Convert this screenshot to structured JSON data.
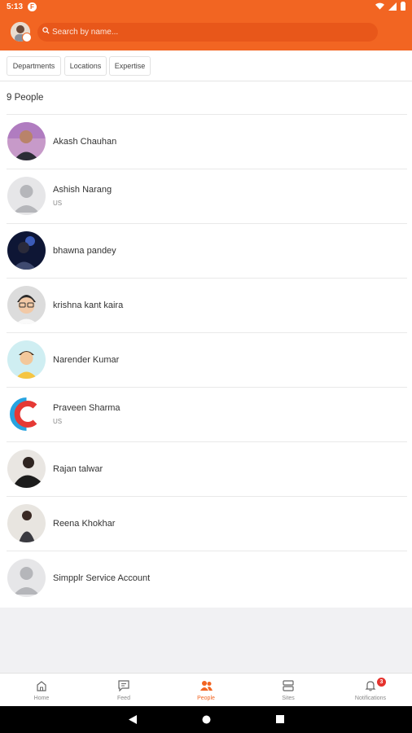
{
  "status_bar": {
    "time": "5:13",
    "app_icon": "F"
  },
  "search": {
    "placeholder": "Search by name..."
  },
  "filters": [
    {
      "label": "Departments"
    },
    {
      "label": "Locations"
    },
    {
      "label": "Expertise"
    }
  ],
  "people_count": "9 People",
  "people": [
    {
      "name": "Akash Chauhan",
      "location": "",
      "avatar": "photo"
    },
    {
      "name": "Ashish Narang",
      "location": "US",
      "avatar": "default"
    },
    {
      "name": "bhawna pandey",
      "location": "",
      "avatar": "photo"
    },
    {
      "name": "krishna kant kaira",
      "location": "",
      "avatar": "cartoon"
    },
    {
      "name": "Narender Kumar",
      "location": "",
      "avatar": "cartoon"
    },
    {
      "name": "Praveen Sharma",
      "location": "US",
      "avatar": "logo"
    },
    {
      "name": "Rajan talwar",
      "location": "",
      "avatar": "photo"
    },
    {
      "name": "Reena Khokhar",
      "location": "",
      "avatar": "photo"
    },
    {
      "name": "Simpplr Service Account",
      "location": "",
      "avatar": "default"
    }
  ],
  "bottom_nav": {
    "items": [
      {
        "label": "Home",
        "icon": "home-icon"
      },
      {
        "label": "Feed",
        "icon": "feed-icon"
      },
      {
        "label": "People",
        "icon": "people-icon",
        "active": true
      },
      {
        "label": "Sites",
        "icon": "sites-icon"
      },
      {
        "label": "Notifications",
        "icon": "bell-icon",
        "badge": "3"
      }
    ]
  },
  "colors": {
    "brand": "#f26522",
    "badge": "#e5322d"
  }
}
